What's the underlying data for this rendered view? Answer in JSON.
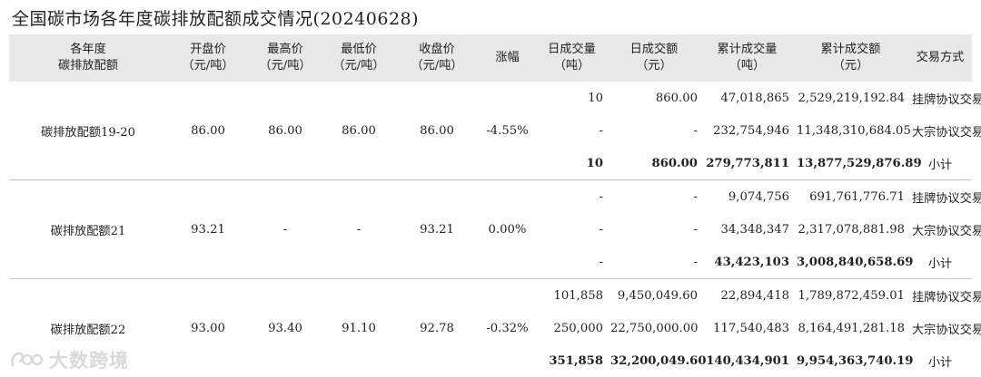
{
  "title": "全国碳市场各年度碳排放配额成交情况(20240628)",
  "headers": {
    "name": [
      "各年度",
      "碳排放配额"
    ],
    "open": [
      "开盘价",
      "（元/吨）"
    ],
    "high": [
      "最高价",
      "（元/吨）"
    ],
    "low": [
      "最低价",
      "（元/吨）"
    ],
    "close": [
      "收盘价",
      "（元/吨）"
    ],
    "change": "涨幅",
    "daily_vol": [
      "日成交量",
      "（吨）"
    ],
    "daily_amt": [
      "日成交额",
      "（元）"
    ],
    "cum_vol": [
      "累计成交量",
      "（吨）"
    ],
    "cum_amt": [
      "累计成交额",
      "（元）"
    ],
    "mode": "交易方式"
  },
  "groups": [
    {
      "name": "碳排放配额19-20",
      "open": "86.00",
      "high": "86.00",
      "low": "86.00",
      "close": "86.00",
      "change": "-4.55%",
      "rows": [
        {
          "daily_vol": "10",
          "daily_amt": "860.00",
          "cum_vol": "47,018,865",
          "cum_amt": "2,529,219,192.84",
          "mode": "挂牌协议交易"
        },
        {
          "daily_vol": "-",
          "daily_amt": "-",
          "cum_vol": "232,754,946",
          "cum_amt": "11,348,310,684.05",
          "mode": "大宗协议交易"
        },
        {
          "daily_vol": "10",
          "daily_amt": "860.00",
          "cum_vol": "279,773,811",
          "cum_amt": "13,877,529,876.89",
          "mode": "小计"
        }
      ]
    },
    {
      "name": "碳排放配额21",
      "open": "93.21",
      "high": "-",
      "low": "-",
      "close": "93.21",
      "change": "0.00%",
      "rows": [
        {
          "daily_vol": "-",
          "daily_amt": "-",
          "cum_vol": "9,074,756",
          "cum_amt": "691,761,776.71",
          "mode": "挂牌协议交易"
        },
        {
          "daily_vol": "-",
          "daily_amt": "-",
          "cum_vol": "34,348,347",
          "cum_amt": "2,317,078,881.98",
          "mode": "大宗协议交易"
        },
        {
          "daily_vol": "-",
          "daily_amt": "-",
          "cum_vol": "43,423,103",
          "cum_amt": "3,008,840,658.69",
          "mode": "小计"
        }
      ]
    },
    {
      "name": "碳排放配额22",
      "open": "93.00",
      "high": "93.40",
      "low": "91.10",
      "close": "92.78",
      "change": "-0.32%",
      "rows": [
        {
          "daily_vol": "101,858",
          "daily_amt": "9,450,049.60",
          "cum_vol": "22,894,418",
          "cum_amt": "1,789,872,459.01",
          "mode": "挂牌协议交易"
        },
        {
          "daily_vol": "250,000",
          "daily_amt": "22,750,000.00",
          "cum_vol": "117,540,483",
          "cum_amt": "8,164,491,281.18",
          "mode": "大宗协议交易"
        },
        {
          "daily_vol": "351,858",
          "daily_amt": "32,200,049.60",
          "cum_vol": "140,434,901",
          "cum_amt": "9,954,363,740.19",
          "mode": "小计"
        }
      ]
    }
  ],
  "watermark": {
    "text": "大数跨境",
    "icon": "brand-logo-icon"
  }
}
